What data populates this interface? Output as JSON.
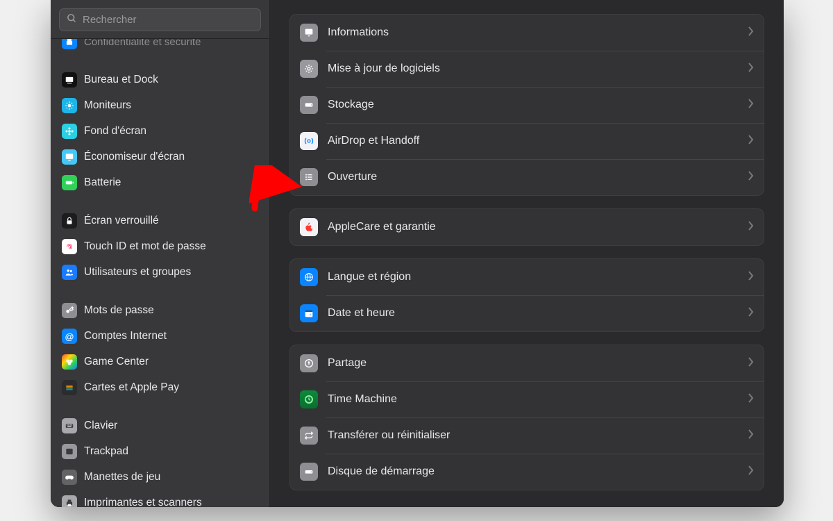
{
  "search": {
    "placeholder": "Rechercher"
  },
  "sidebar": {
    "cutoff": {
      "label": "Confidentialité et sécurité"
    },
    "groups": [
      [
        {
          "key": "desktop-dock",
          "label": "Bureau et Dock"
        },
        {
          "key": "displays",
          "label": "Moniteurs"
        },
        {
          "key": "wallpaper",
          "label": "Fond d'écran"
        },
        {
          "key": "screensaver",
          "label": "Économiseur d'écran"
        },
        {
          "key": "battery",
          "label": "Batterie"
        }
      ],
      [
        {
          "key": "lockscreen",
          "label": "Écran verrouillé"
        },
        {
          "key": "touchid",
          "label": "Touch ID et mot de passe"
        },
        {
          "key": "users",
          "label": "Utilisateurs et groupes"
        }
      ],
      [
        {
          "key": "passwords",
          "label": "Mots de passe"
        },
        {
          "key": "internet-accounts",
          "label": "Comptes Internet"
        },
        {
          "key": "game-center",
          "label": "Game Center"
        },
        {
          "key": "wallet",
          "label": "Cartes et Apple Pay"
        }
      ],
      [
        {
          "key": "keyboard",
          "label": "Clavier"
        },
        {
          "key": "trackpad",
          "label": "Trackpad"
        },
        {
          "key": "game-controllers",
          "label": "Manettes de jeu"
        },
        {
          "key": "printers",
          "label": "Imprimantes et scanners"
        }
      ]
    ]
  },
  "main": {
    "panels": [
      [
        {
          "key": "about",
          "label": "Informations"
        },
        {
          "key": "software-update",
          "label": "Mise à jour de logiciels"
        },
        {
          "key": "storage",
          "label": "Stockage"
        },
        {
          "key": "airdrop-handoff",
          "label": "AirDrop et Handoff"
        },
        {
          "key": "login-items",
          "label": "Ouverture"
        }
      ],
      [
        {
          "key": "applecare",
          "label": "AppleCare et garantie"
        }
      ],
      [
        {
          "key": "language-region",
          "label": "Langue et région"
        },
        {
          "key": "date-time",
          "label": "Date et heure"
        }
      ],
      [
        {
          "key": "sharing",
          "label": "Partage"
        },
        {
          "key": "time-machine",
          "label": "Time Machine"
        },
        {
          "key": "transfer-reset",
          "label": "Transférer ou réinitialiser"
        },
        {
          "key": "startup-disk",
          "label": "Disque de démarrage"
        }
      ]
    ]
  },
  "annotation": {
    "type": "arrow",
    "target": "login-items",
    "color": "#ff0000"
  }
}
